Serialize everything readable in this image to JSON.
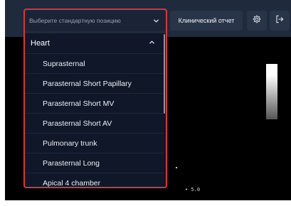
{
  "header": {
    "position_select": {
      "placeholder": "Выберите стандартную позицию",
      "chevron_icon": "chevron-down-icon"
    },
    "report_button_label": "Клинический отчет",
    "settings_icon": "gear-icon",
    "logout_icon": "logout-icon"
  },
  "dropdown": {
    "group": {
      "label": "Heart",
      "expanded": true,
      "chevron_icon": "chevron-up-icon"
    },
    "items": [
      {
        "label": "Suprasternal"
      },
      {
        "label": "Parasternal Short Papillary"
      },
      {
        "label": "Parasternal Short MV"
      },
      {
        "label": "Parasternal Short AV"
      },
      {
        "label": "Pulmonary trunk"
      },
      {
        "label": "Parasternal Long"
      },
      {
        "label": "Apical 4 chamber"
      }
    ]
  },
  "viewport": {
    "depth_marker": "• 5.0"
  },
  "colors": {
    "highlight": "#e0313a",
    "topbar": "#1f2a3d",
    "dropdown_bg": "#0f1728"
  }
}
